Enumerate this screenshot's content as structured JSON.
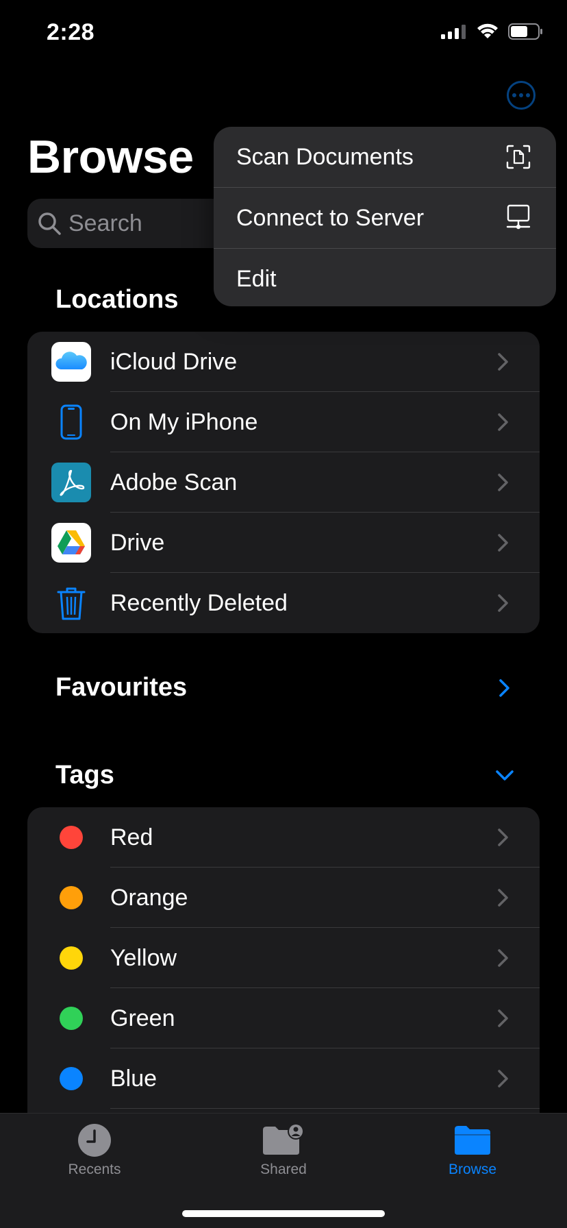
{
  "status_bar": {
    "time": "2:28",
    "icons": [
      "signal-icon",
      "wifi-icon",
      "battery-icon"
    ]
  },
  "header": {
    "title": "Browse",
    "more_icon": "ellipsis-icon"
  },
  "search": {
    "placeholder": "Search"
  },
  "locations": {
    "title": "Locations",
    "items": [
      {
        "label": "iCloud Drive",
        "icon": "icloud-drive-icon"
      },
      {
        "label": "On My iPhone",
        "icon": "iphone-icon"
      },
      {
        "label": "Adobe Scan",
        "icon": "adobe-scan-icon"
      },
      {
        "label": "Drive",
        "icon": "google-drive-icon"
      },
      {
        "label": "Recently Deleted",
        "icon": "trash-icon"
      }
    ]
  },
  "favourites": {
    "title": "Favourites"
  },
  "tags": {
    "title": "Tags",
    "items": [
      {
        "label": "Red",
        "color": "#ff453a"
      },
      {
        "label": "Orange",
        "color": "#ff9f0a"
      },
      {
        "label": "Yellow",
        "color": "#ffd60a"
      },
      {
        "label": "Green",
        "color": "#30d158"
      },
      {
        "label": "Blue",
        "color": "#0a84ff"
      }
    ]
  },
  "context_menu": {
    "items": [
      {
        "label": "Scan Documents",
        "icon": "scan-document-icon"
      },
      {
        "label": "Connect to Server",
        "icon": "server-icon"
      },
      {
        "label": "Edit",
        "icon": ""
      }
    ]
  },
  "tab_bar": {
    "tabs": [
      {
        "label": "Recents",
        "icon": "clock-icon",
        "active": false
      },
      {
        "label": "Shared",
        "icon": "shared-folder-icon",
        "active": false
      },
      {
        "label": "Browse",
        "icon": "folder-icon",
        "active": true
      }
    ]
  },
  "colors": {
    "accent": "#0a84ff",
    "background": "#000000",
    "group_background": "#1c1c1e",
    "menu_background": "#2c2c2e",
    "secondary_text": "#8e8e93",
    "inactive_tab": "#8e8e93"
  }
}
